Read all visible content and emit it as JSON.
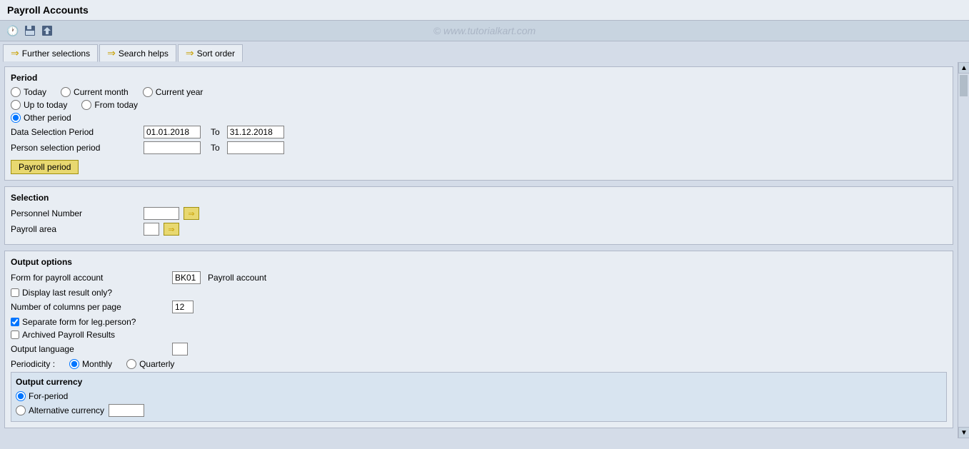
{
  "title": "Payroll Accounts",
  "watermark": "© www.tutorialkart.com",
  "toolbar": {
    "icons": [
      "clock",
      "save",
      "export"
    ]
  },
  "tabs": [
    {
      "label": "Further selections",
      "active": false,
      "arrow": "⇒"
    },
    {
      "label": "Search helps",
      "active": false,
      "arrow": "⇒"
    },
    {
      "label": "Sort order",
      "active": false,
      "arrow": ""
    }
  ],
  "period_section": {
    "title": "Period",
    "options_row1": [
      {
        "id": "today",
        "label": "Today",
        "checked": false
      },
      {
        "id": "current_month",
        "label": "Current month",
        "checked": false
      },
      {
        "id": "current_year",
        "label": "Current year",
        "checked": false
      }
    ],
    "options_row2": [
      {
        "id": "up_to_today",
        "label": "Up to today",
        "checked": false
      },
      {
        "id": "from_today",
        "label": "From today",
        "checked": false
      }
    ],
    "other_period": {
      "id": "other_period",
      "label": "Other period",
      "checked": true
    },
    "data_selection_period": {
      "label": "Data Selection Period",
      "from": "01.01.2018",
      "to": "31.12.2018",
      "to_label": "To"
    },
    "person_selection_period": {
      "label": "Person selection period",
      "from": "",
      "to": "",
      "to_label": "To"
    },
    "payroll_period_btn": "Payroll period"
  },
  "selection_section": {
    "title": "Selection",
    "fields": [
      {
        "label": "Personnel Number",
        "value": "",
        "width": "50"
      },
      {
        "label": "Payroll area",
        "value": "",
        "width": "22"
      }
    ]
  },
  "output_options": {
    "title": "Output options",
    "form_label": "Form for payroll account",
    "form_value": "BK01",
    "form_desc": "Payroll account",
    "display_last_result": {
      "label": "Display last result only?",
      "checked": false
    },
    "columns_per_page": {
      "label": "Number of columns per page",
      "value": "12"
    },
    "separate_form": {
      "label": "Separate form for leg.person?",
      "checked": true
    },
    "archived_payroll": {
      "label": "Archived Payroll Results",
      "checked": false
    },
    "output_language": {
      "label": "Output language",
      "value": ""
    },
    "periodicity_label": "Periodicity :",
    "periodicity_options": [
      {
        "id": "monthly",
        "label": "Monthly",
        "checked": true
      },
      {
        "id": "quarterly",
        "label": "Quarterly",
        "checked": false
      }
    ],
    "output_currency": {
      "title": "Output currency",
      "options": [
        {
          "id": "for_period",
          "label": "For-period",
          "checked": true
        },
        {
          "id": "alternative",
          "label": "Alternative currency",
          "checked": false,
          "value": ""
        }
      ]
    }
  }
}
